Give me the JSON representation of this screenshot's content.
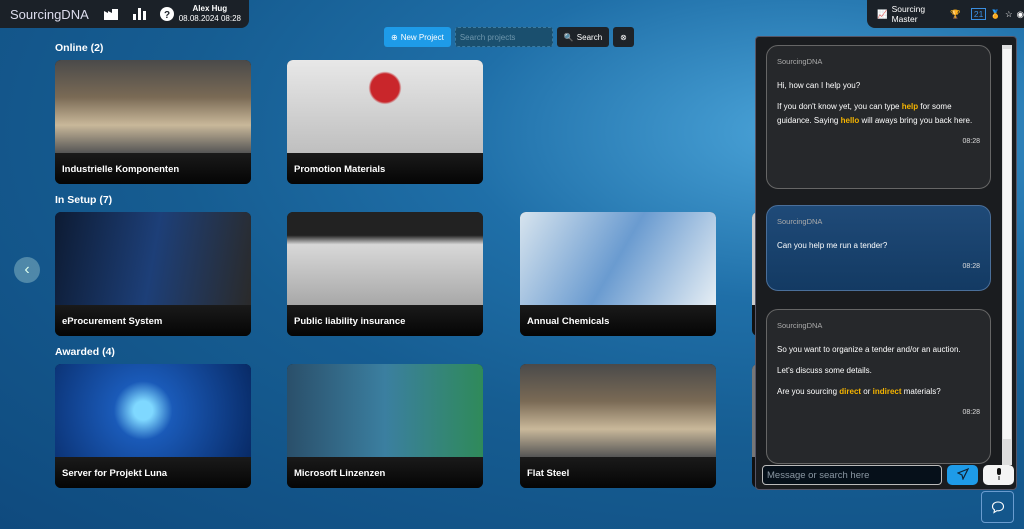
{
  "header": {
    "logo": "SourcingDNA",
    "user_name": "Alex Hug",
    "datetime": "08.08.2024 08:28",
    "icons": [
      "factory-icon",
      "bar-chart-icon",
      "help-icon"
    ]
  },
  "status": {
    "rank_label": "Sourcing Master",
    "level": "21",
    "icons": [
      "chart-line-icon",
      "trophy-icon",
      "medal-icon",
      "star-icon",
      "badge-icon"
    ]
  },
  "toolbar": {
    "new_project": "New Project",
    "search_placeholder": "Search projects",
    "search_button": "Search"
  },
  "sections": [
    {
      "title": "Online (2)",
      "cards": [
        {
          "label": "Industrielle Komponenten"
        },
        {
          "label": "Promotion Materials"
        }
      ]
    },
    {
      "title": "In Setup (7)",
      "cards": [
        {
          "label": "eProcurement System"
        },
        {
          "label": "Public liability insurance"
        },
        {
          "label": "Annual Chemicals"
        }
      ]
    },
    {
      "title": "Awarded (4)",
      "cards": [
        {
          "label": "Server for Projekt Luna"
        },
        {
          "label": "Microsoft Linzenzen"
        },
        {
          "label": "Flat Steel"
        }
      ]
    }
  ],
  "chat": {
    "messages": [
      {
        "from": "SourcingDNA",
        "p1": "Hi, how can I help you?",
        "p2a": "If you don't know yet, you can type ",
        "k1": "help",
        "p2b": " for some guidance. Saying ",
        "k2": "hello",
        "p2c": " will aways bring you back here.",
        "time": "08:28"
      },
      {
        "from": "SourcingDNA",
        "p1": "Can you help me run a tender?",
        "time": "08:28"
      },
      {
        "from": "SourcingDNA",
        "p1": "So you want to organize a tender and/or an auction.",
        "p2": "Let's discuss some details.",
        "p3a": "Are you sourcing ",
        "k1": "direct",
        "p3b": " or ",
        "k2": "indirect",
        "p3c": " materials?",
        "time": "08:28"
      }
    ],
    "input_placeholder": "Message or search here"
  },
  "colors": {
    "accent": "#1e9be8",
    "highlight": "#f5b400",
    "panel": "#1b2128"
  }
}
